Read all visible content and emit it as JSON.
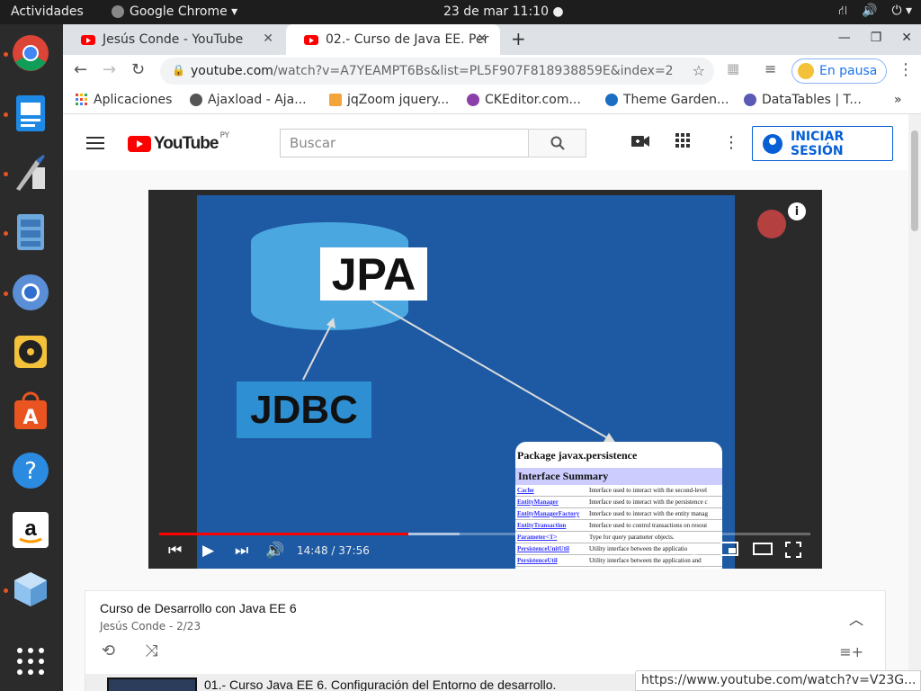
{
  "topbar": {
    "activities": "Actividades",
    "app_name": "Google Chrome ▾",
    "clock": "23 de mar  11:10 ●",
    "tray": [
      "network-icon",
      "volume-icon",
      "power-icon"
    ]
  },
  "dock": {
    "items": [
      "chrome-icon",
      "document-viewer-icon",
      "paint-icon",
      "file-cabinet-icon",
      "chromium-icon",
      "rhythmbox-icon",
      "software-center-icon",
      "help-icon",
      "amazon-icon",
      "virtualbox-icon",
      "apps-grid-icon"
    ]
  },
  "tabs": [
    {
      "title": "Jesús Conde - YouTube",
      "active": false
    },
    {
      "title": "02.- Curso de Java EE. Per",
      "active": true
    }
  ],
  "toolbar": {
    "url_host": "youtube.com",
    "url_path": "/watch?v=A7YEAMPT6Bs&list=PL5F907F818938859E&index=2",
    "profile_label": "En pausa"
  },
  "bookmarks": {
    "items": [
      "Aplicaciones",
      "Ajaxload - Aja...",
      "jqZoom jquery...",
      "CKEditor.com...",
      "Theme Garden...",
      "DataTables | T..."
    ],
    "overflow": "»"
  },
  "youtube": {
    "logo_text": "YouTube",
    "region": "PY",
    "search_placeholder": "Buscar",
    "signin_label": "INICIAR SESIÓN"
  },
  "video": {
    "slide": {
      "jpa": "JPA",
      "jdbc": "JDBC",
      "package_title": "Package javax.persistence",
      "summary_header": "Interface Summary",
      "rows": [
        {
          "name": "Cache",
          "desc": "Interface used to interact with the second-level"
        },
        {
          "name": "EntityManager",
          "desc": "Interface used to interact with the persistence c"
        },
        {
          "name": "EntityManagerFactory",
          "desc": "Interface used to interact with the entity manag"
        },
        {
          "name": "EntityTransaction",
          "desc": "Interface used to control transactions on resour"
        },
        {
          "name": "Parameter<T>",
          "desc": "Type for query parameter objects."
        },
        {
          "name": "PersistenceUnitUtil",
          "desc": "Utility interface between the applicatio"
        },
        {
          "name": "PersistenceUtil",
          "desc": "Utility interface between the application and"
        }
      ]
    },
    "time": "14:48 / 37:56",
    "progress_played": 0.382,
    "progress_loaded": 0.462
  },
  "playlist": {
    "title": "Curso de Desarrollo con Java EE 6",
    "author": "Jesús Conde",
    "position": " - 2/23",
    "first_item": "01.- Curso Java EE 6. Configuración del Entorno de desarrollo."
  },
  "status_url": "https://www.youtube.com/watch?v=V23G..."
}
